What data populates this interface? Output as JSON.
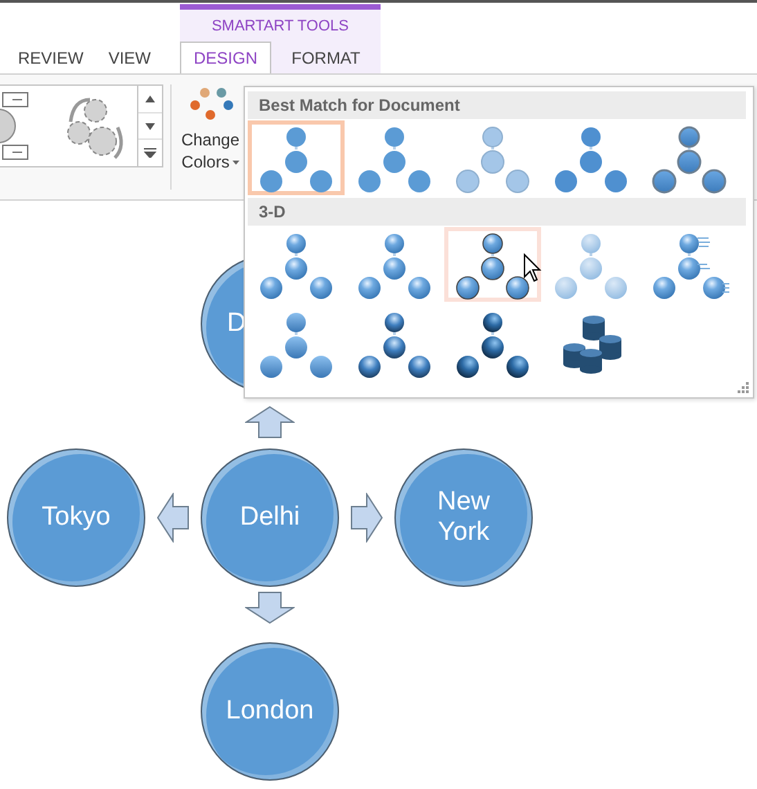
{
  "ribbon": {
    "tabs": [
      {
        "label": "REVIEW",
        "selected": false
      },
      {
        "label": "VIEW",
        "selected": false
      }
    ],
    "smartart_tools": {
      "label": "SMARTART TOOLS",
      "tabs": [
        {
          "label": "DESIGN",
          "selected": true
        },
        {
          "label": "FORMAT",
          "selected": false
        }
      ]
    },
    "change_colors_button": {
      "lines": [
        "Change",
        "Colors"
      ]
    }
  },
  "color_gallery": {
    "sections": [
      {
        "title": "Best Match for Document",
        "items": [
          {
            "kind": "flat",
            "selected": true,
            "hovered": false
          },
          {
            "kind": "flat",
            "selected": false,
            "hovered": false
          },
          {
            "kind": "pale",
            "selected": false,
            "hovered": false
          },
          {
            "kind": "bold",
            "selected": false,
            "hovered": false
          },
          {
            "kind": "shadow",
            "selected": false,
            "hovered": false
          }
        ]
      },
      {
        "title": "3-D",
        "items": [
          {
            "kind": "glossy",
            "selected": false,
            "hovered": false
          },
          {
            "kind": "glossy",
            "selected": false,
            "hovered": false
          },
          {
            "kind": "outlined",
            "selected": false,
            "hovered": true
          },
          {
            "kind": "faded",
            "selected": false,
            "hovered": false
          },
          {
            "kind": "streaked",
            "selected": false,
            "hovered": false
          },
          {
            "kind": "bevel",
            "selected": false,
            "hovered": false
          },
          {
            "kind": "metal",
            "selected": false,
            "hovered": false
          },
          {
            "kind": "dark-metal",
            "selected": false,
            "hovered": false
          },
          {
            "kind": "cylinder",
            "selected": false,
            "hovered": false
          }
        ]
      }
    ]
  },
  "diagram": {
    "nodes": [
      {
        "label": "D",
        "kind": "top"
      },
      {
        "label": "Tokyo",
        "kind": "left"
      },
      {
        "label": "Delhi",
        "kind": "center"
      },
      {
        "label": "New York",
        "kind": "right"
      },
      {
        "label": "London",
        "kind": "bottom"
      }
    ]
  }
}
